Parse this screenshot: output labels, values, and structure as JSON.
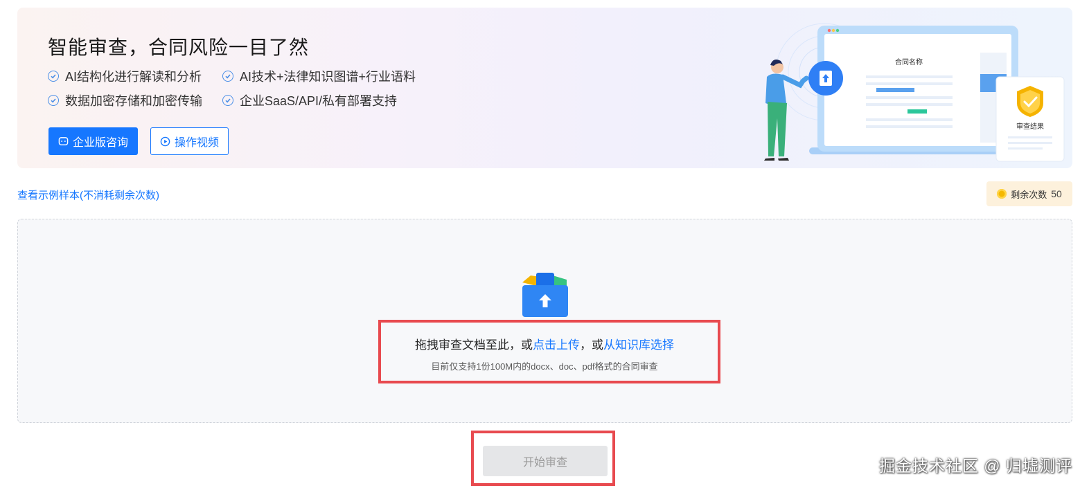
{
  "banner": {
    "title": "智能审查，合同风险一目了然",
    "features": [
      "AI结构化进行解读和分析",
      "AI技术+法律知识图谱+行业语料",
      "数据加密存储和加密传输",
      "企业SaaS/API/私有部署支持"
    ],
    "enterprise_button": "企业版咨询",
    "video_button": "操作视频",
    "illustration": {
      "contract_name": "合同名称",
      "review_result": "审查结果"
    }
  },
  "sample_link": "查看示例样本(不消耗剩余次数)",
  "remaining": {
    "label": "剩余次数",
    "count": "50"
  },
  "dropzone": {
    "text_before": "拖拽审查文档至此，或",
    "click_upload": "点击上传",
    "text_middle": "，或",
    "from_kb": "从知识库选择",
    "hint": "目前仅支持1份100M内的docx、doc、pdf格式的合同审查"
  },
  "start_button": "开始审查",
  "watermark": "掘金技术社区 @ 归墟测评",
  "colors": {
    "primary": "#1677ff",
    "highlight": "#e84a4f",
    "coin": "#f5b800"
  }
}
